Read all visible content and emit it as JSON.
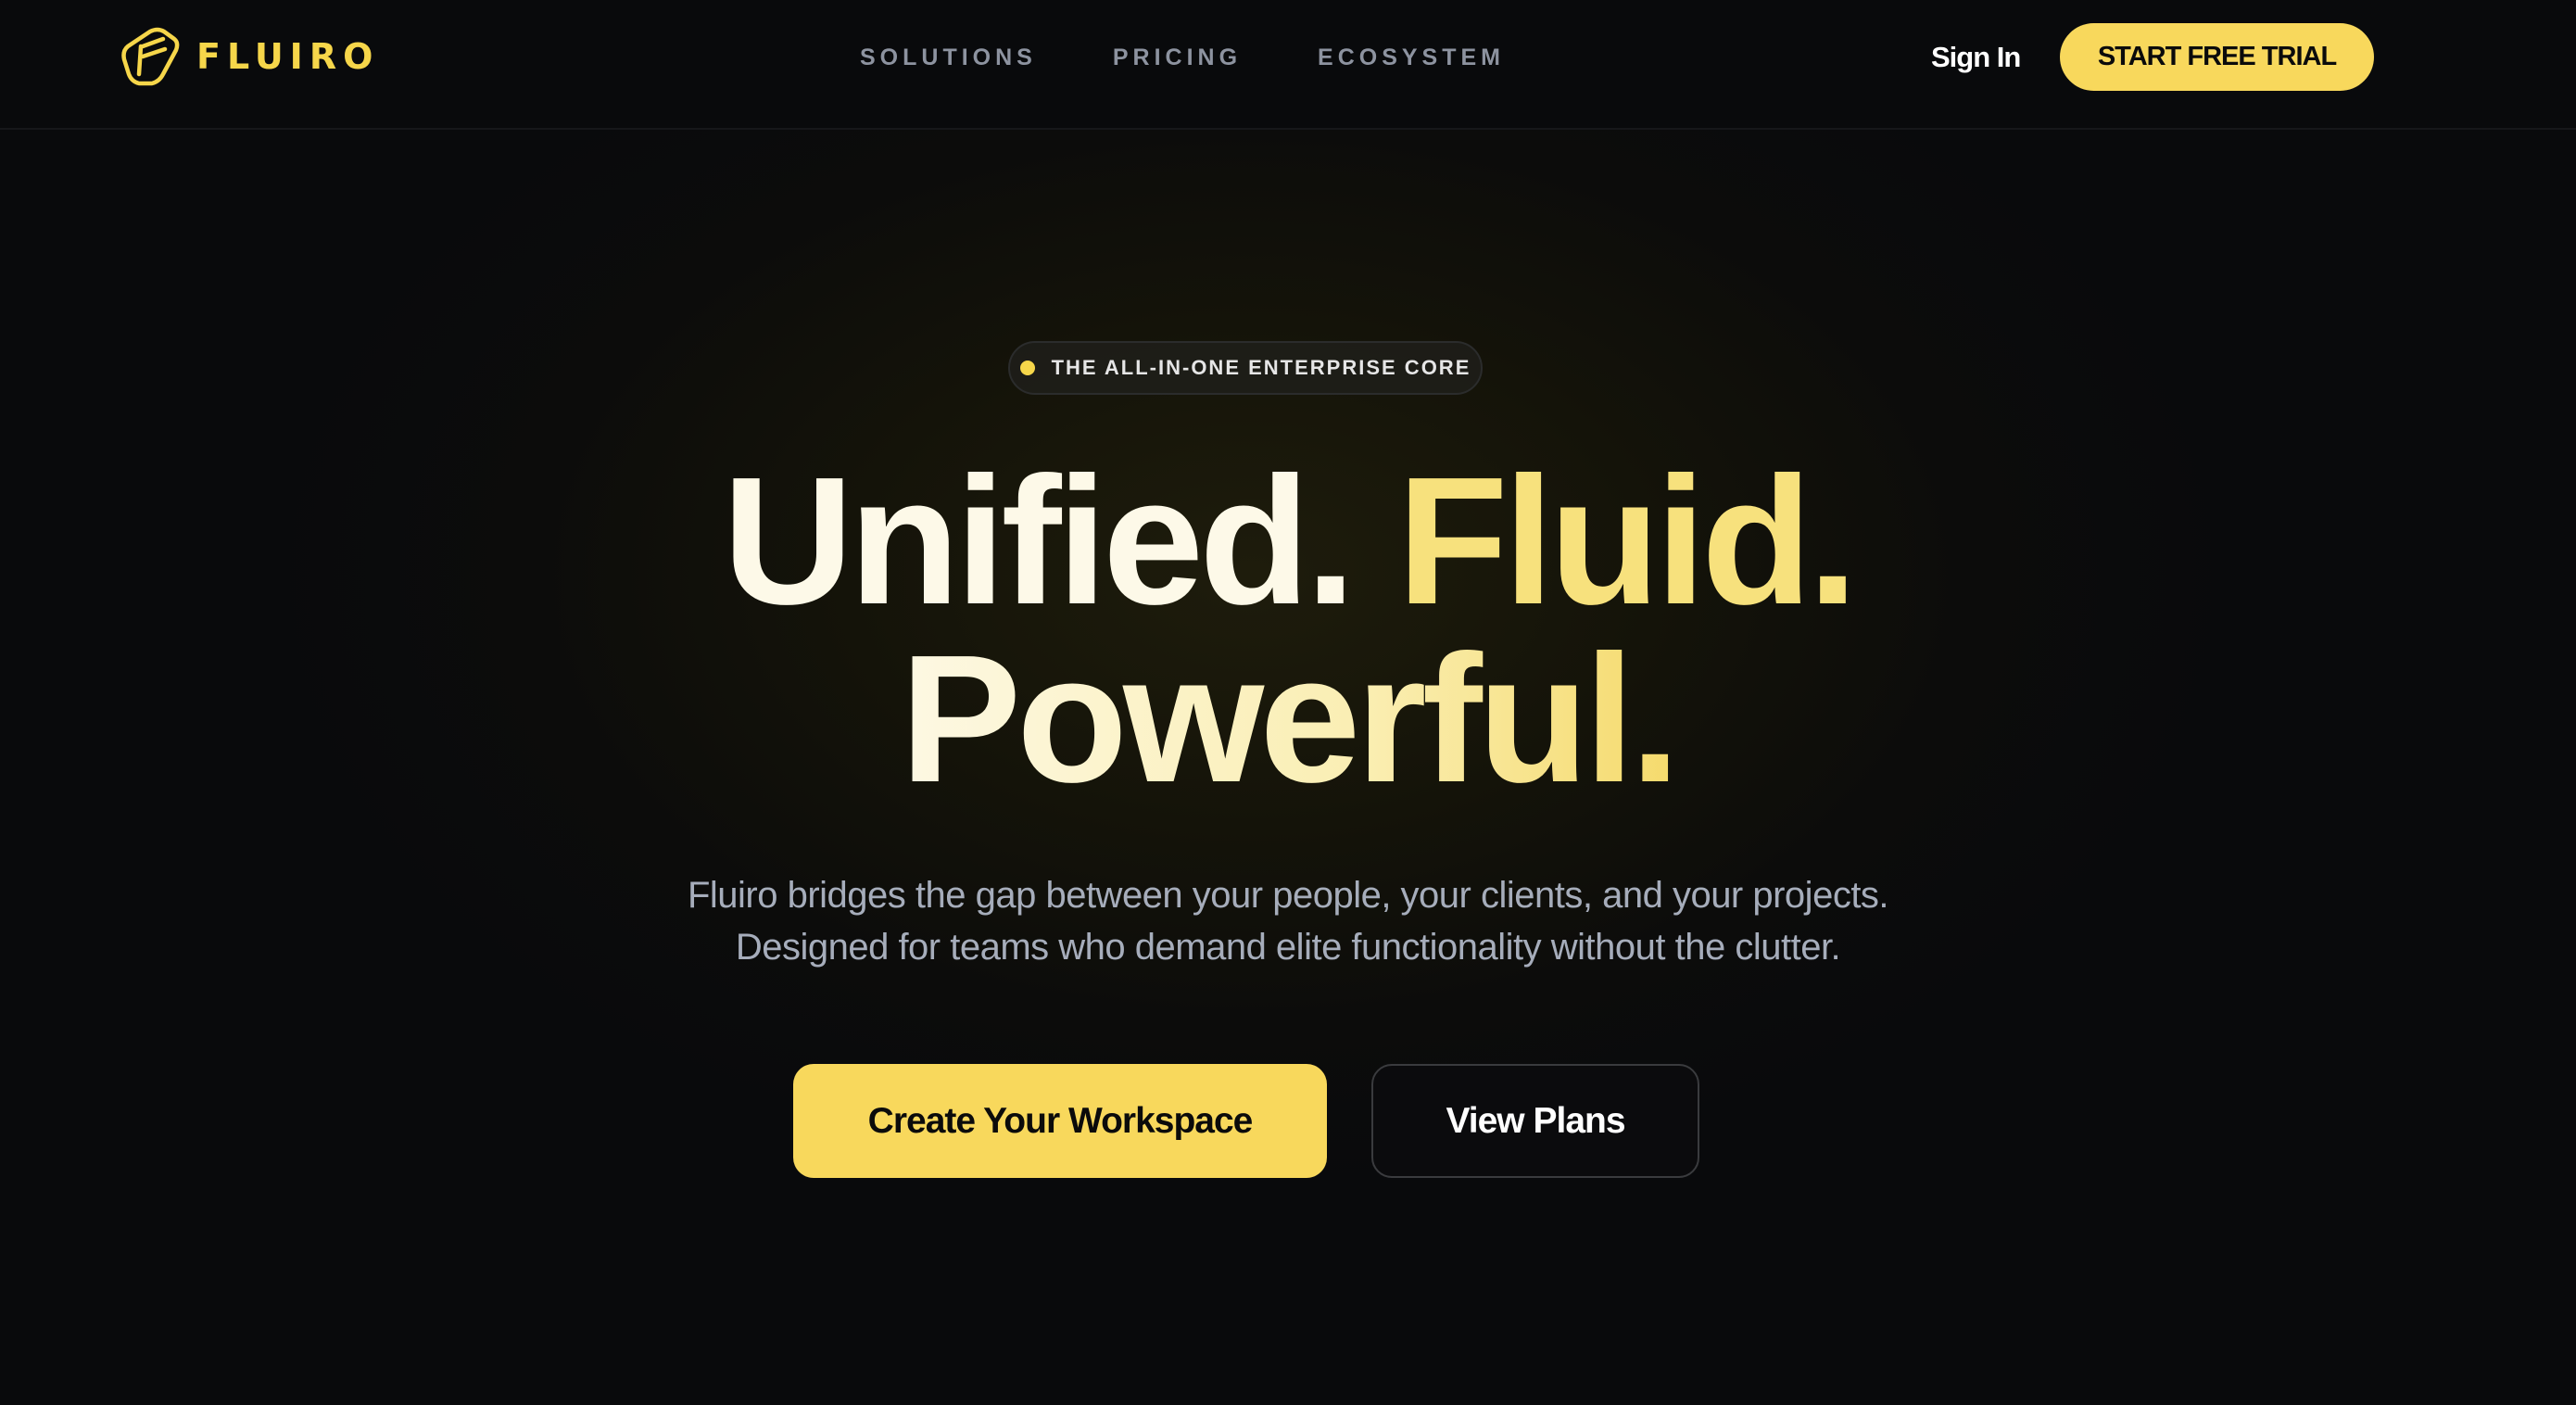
{
  "brand": {
    "name": "FLUIRO",
    "logo_icon": "fluiro-logo-icon",
    "color": "#f6d64a"
  },
  "nav": {
    "links": [
      {
        "label": "SOLUTIONS"
      },
      {
        "label": "PRICING"
      },
      {
        "label": "ECOSYSTEM"
      }
    ],
    "sign_in_label": "Sign In",
    "trial_label": "START FREE TRIAL"
  },
  "hero": {
    "eyebrow": "THE ALL-IN-ONE ENTERPRISE CORE",
    "headline": {
      "part1": "Unified.",
      "part2": "Fluid.",
      "part3": "Powerful."
    },
    "subtitle_line1": "Fluiro bridges the gap between your people, your clients, and your projects.",
    "subtitle_line2": "Designed for teams who demand elite functionality without the clutter.",
    "primary_cta": "Create Your Workspace",
    "secondary_cta": "View Plans"
  },
  "colors": {
    "accent": "#f8d85c",
    "background": "#090a0c",
    "muted_text": "#a6adbb"
  }
}
